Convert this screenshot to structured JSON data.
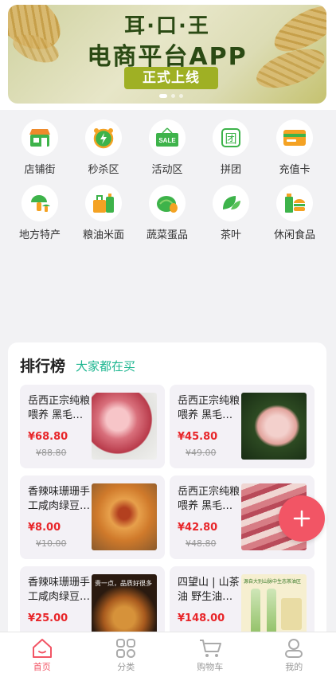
{
  "banner": {
    "line1": "耳·口·王",
    "line2": "电商平台APP",
    "cta": "正式上线"
  },
  "categories": [
    {
      "label": "店铺街",
      "icon": "storefront-icon",
      "color": "#3db34a"
    },
    {
      "label": "秒杀区",
      "icon": "alarm-clock-icon",
      "color": "#f4a223"
    },
    {
      "label": "活动区",
      "icon": "sale-sign-icon",
      "color": "#3db34a"
    },
    {
      "label": "拼团",
      "icon": "group-buy-icon",
      "color": "#3db34a"
    },
    {
      "label": "充值卡",
      "icon": "card-icon",
      "color": "#f4a223"
    },
    {
      "label": "地方特产",
      "icon": "mushroom-icon",
      "color": "#3db34a"
    },
    {
      "label": "粮油米面",
      "icon": "grain-oil-icon",
      "color": "#f4a223"
    },
    {
      "label": "蔬菜蛋品",
      "icon": "vegetable-icon",
      "color": "#3db34a"
    },
    {
      "label": "茶叶",
      "icon": "tea-leaf-icon",
      "color": "#3db34a"
    },
    {
      "label": "休闲食品",
      "icon": "snack-icon",
      "color": "#f4a223"
    }
  ],
  "ranking": {
    "title": "排行榜",
    "subtitle": "大家都在买",
    "products": [
      {
        "name": "岳西正宗纯粮喂养 黑毛…",
        "price": "¥68.80",
        "old_price": "¥88.80",
        "image": "pork-image"
      },
      {
        "name": "岳西正宗纯粮喂养 黑毛…",
        "price": "¥45.80",
        "old_price": "¥49.00",
        "image": "pork-leg-image"
      },
      {
        "name": "香辣味珊珊手工咸肉绿豆…",
        "price": "¥8.00",
        "old_price": "¥10.00",
        "image": "snack-image"
      },
      {
        "name": "岳西正宗纯粮喂养 黑毛…",
        "price": "¥42.80",
        "old_price": "¥48.80",
        "image": "pork-slab-image"
      },
      {
        "name": "香辣味珊珊手工咸肉绿豆…",
        "price": "¥25.00",
        "old_price": "",
        "image": "snack-promo-image",
        "image_caption": "贵一点，品质好很多"
      },
      {
        "name": "四望山 | 山茶油 野生油…",
        "price": "¥148.00",
        "old_price": "",
        "image": "oil-bottles-image",
        "image_caption": "源自大别山脉中生态茶油区"
      }
    ]
  },
  "tabs": [
    {
      "label": "首页",
      "icon": "home-icon",
      "active": true
    },
    {
      "label": "分类",
      "icon": "category-grid-icon",
      "active": false
    },
    {
      "label": "购物车",
      "icon": "cart-icon",
      "active": false
    },
    {
      "label": "我的",
      "icon": "profile-icon",
      "active": false
    }
  ],
  "colors": {
    "accent": "#f25565",
    "price": "#e8262a",
    "green": "#3db34a",
    "subtitle": "#1bb58f"
  }
}
